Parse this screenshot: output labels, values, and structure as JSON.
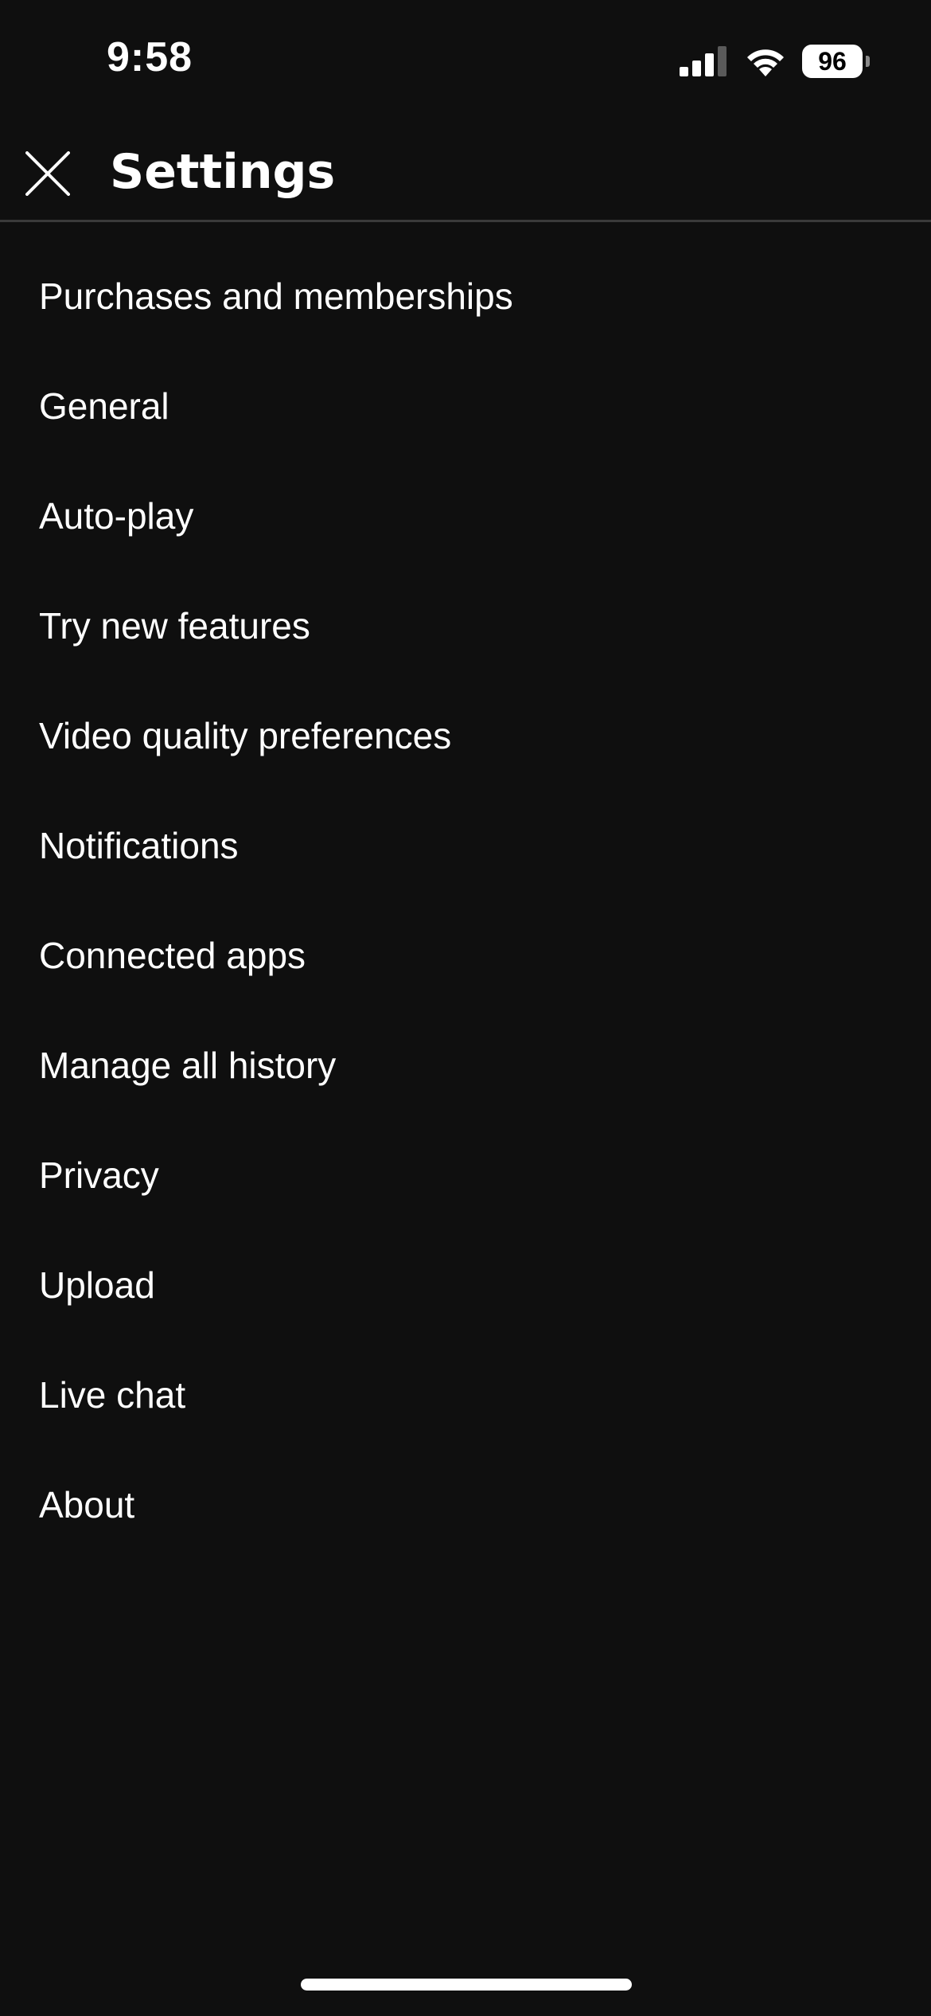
{
  "status_bar": {
    "time": "9:58",
    "battery_level": "96",
    "signal_icon": "cellular-signal-icon",
    "wifi_icon": "wifi-icon"
  },
  "header": {
    "title": "Settings",
    "close_icon": "close-icon"
  },
  "menu": {
    "items": [
      {
        "label": "Purchases and memberships"
      },
      {
        "label": "General"
      },
      {
        "label": "Auto-play"
      },
      {
        "label": "Try new features"
      },
      {
        "label": "Video quality preferences"
      },
      {
        "label": "Notifications"
      },
      {
        "label": "Connected apps"
      },
      {
        "label": "Manage all history"
      },
      {
        "label": "Privacy"
      },
      {
        "label": "Upload"
      },
      {
        "label": "Live chat"
      },
      {
        "label": "About"
      }
    ]
  },
  "colors": {
    "background": "#0f0f0f",
    "text": "#ffffff",
    "divider": "#3a3a3a"
  }
}
